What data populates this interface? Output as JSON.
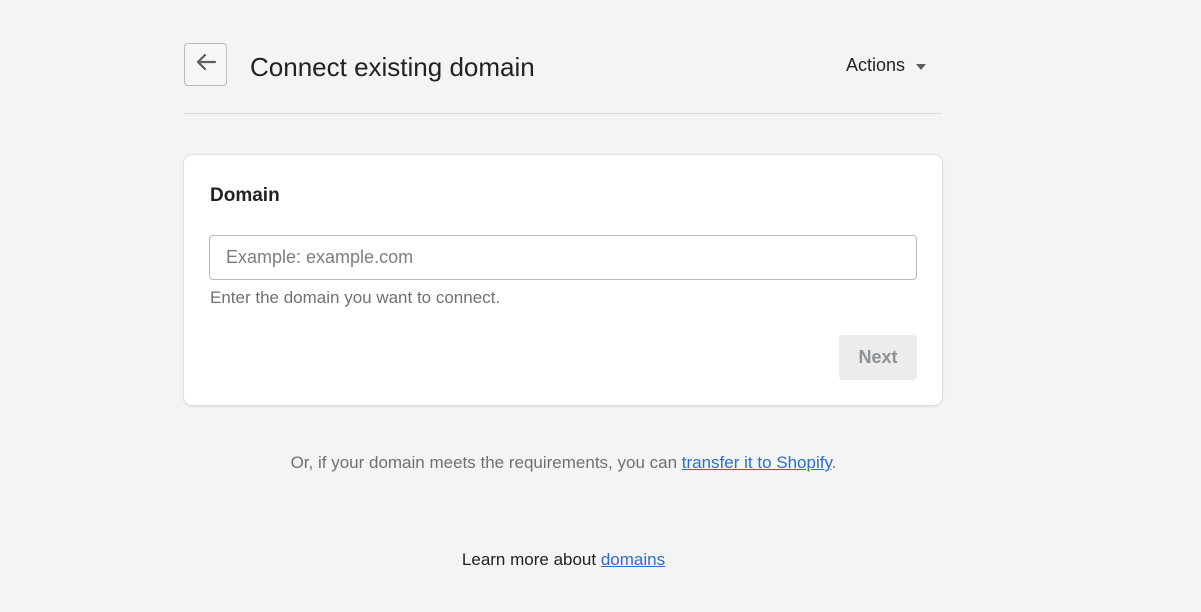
{
  "header": {
    "back_icon": "arrow-left-icon",
    "title": "Connect existing domain",
    "actions_label": "Actions",
    "actions_icon": "caret-down-icon"
  },
  "card": {
    "title": "Domain",
    "input": {
      "value": "",
      "placeholder": "Example: example.com"
    },
    "help_text": "Enter the domain you want to connect.",
    "next_label": "Next"
  },
  "footer": {
    "transfer_prefix": "Or, if your domain meets the requirements, you can ",
    "transfer_link": "transfer it to Shopify",
    "transfer_suffix": ".",
    "learn_prefix": "Learn more about ",
    "learn_link": "domains"
  },
  "colors": {
    "background": "#f4f4f4",
    "link": "#2c6ecb",
    "disabled_button_bg": "#ececec",
    "disabled_button_text": "#8c9196"
  }
}
